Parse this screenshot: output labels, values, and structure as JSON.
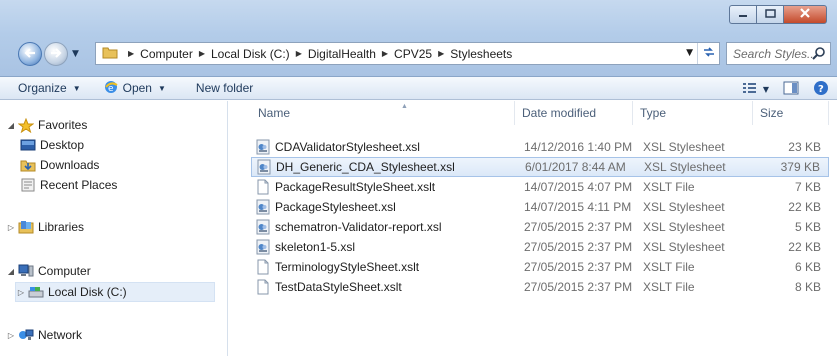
{
  "window": {
    "minimize_icon": "minimize-icon",
    "maximize_icon": "maximize-icon",
    "close_icon": "close-icon"
  },
  "address": {
    "crumbs": [
      "Computer",
      "Local Disk (C:)",
      "DigitalHealth",
      "CPV25",
      "Stylesheets"
    ]
  },
  "search": {
    "placeholder": "Search Styles..."
  },
  "toolbar": {
    "organize": "Organize",
    "open": "Open",
    "new_folder": "New folder"
  },
  "nav": {
    "favorites": "Favorites",
    "desktop": "Desktop",
    "downloads": "Downloads",
    "recent_places": "Recent Places",
    "libraries": "Libraries",
    "computer": "Computer",
    "local_disk": "Local Disk (C:)",
    "network": "Network"
  },
  "columns": {
    "name": "Name",
    "date": "Date modified",
    "type": "Type",
    "size": "Size"
  },
  "files": [
    {
      "name": "CDAValidatorStylesheet.xsl",
      "date": "14/12/2016 1:40 PM",
      "type": "XSL Stylesheet",
      "size": "23 KB",
      "icon": "xsl-file-icon"
    },
    {
      "name": "DH_Generic_CDA_Stylesheet.xsl",
      "date": "6/01/2017 8:44 AM",
      "type": "XSL Stylesheet",
      "size": "379 KB",
      "icon": "xsl-file-icon"
    },
    {
      "name": "PackageResultStyleSheet.xslt",
      "date": "14/07/2015 4:07 PM",
      "type": "XSLT File",
      "size": "7 KB",
      "icon": "blank-file-icon"
    },
    {
      "name": "PackageStylesheet.xsl",
      "date": "14/07/2015 4:11 PM",
      "type": "XSL Stylesheet",
      "size": "22 KB",
      "icon": "xsl-file-icon"
    },
    {
      "name": "schematron-Validator-report.xsl",
      "date": "27/05/2015 2:37 PM",
      "type": "XSL Stylesheet",
      "size": "5 KB",
      "icon": "xsl-file-icon"
    },
    {
      "name": "skeleton1-5.xsl",
      "date": "27/05/2015 2:37 PM",
      "type": "XSL Stylesheet",
      "size": "22 KB",
      "icon": "xsl-file-icon"
    },
    {
      "name": "TerminologyStyleSheet.xslt",
      "date": "27/05/2015 2:37 PM",
      "type": "XSLT File",
      "size": "6 KB",
      "icon": "blank-file-icon"
    },
    {
      "name": "TestDataStyleSheet.xslt",
      "date": "27/05/2015 2:37 PM",
      "type": "XSLT File",
      "size": "8 KB",
      "icon": "blank-file-icon"
    }
  ],
  "colors": {
    "chrome": "#b9d1ea",
    "selection": "#dbe8f8",
    "selection_border": "#a6c3e8",
    "link_text": "#1e395b"
  }
}
